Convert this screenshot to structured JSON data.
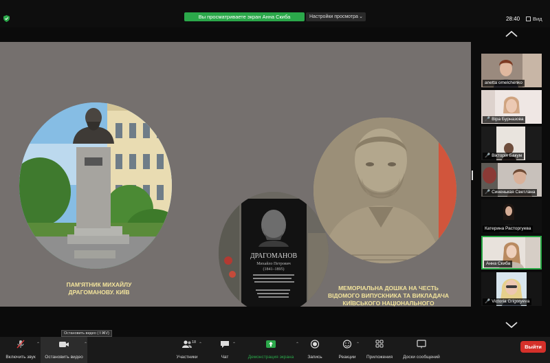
{
  "top_bar": {
    "share_banner": "Вы просматриваете экран Анна Скиба",
    "view_settings": "Настройки просмотра",
    "clock": "28:40",
    "view_label": "Вид"
  },
  "slide": {
    "caption1": "ПАМ'ЯТНИК МИХАЙЛУ ДРАГОМАНОВУ. КИЇВ",
    "caption2": "МЕМОРІАЛЬНА ДОШКА НА ЧЕСТЬ ВІДОМОГО ВИПУСКНИКА ТА ВИКЛАДАЧА КИЇВСЬКОГО НАЦІОНАЛЬНОГО УНІВЕРСИТЕТУ ІМЕНІ Т.ШЕВЧЕНКА",
    "plaque_name": "ДРАГОМАНОВ",
    "plaque_sub": "Михайло Петрович",
    "plaque_years": "(1841–1895)"
  },
  "participants": [
    {
      "name": "anetta omelchenko",
      "muted": false
    },
    {
      "name": "Віра Бурназова",
      "muted": true
    },
    {
      "name": "Вікторія Бакум",
      "muted": true
    },
    {
      "name": "Синенькая Светлана",
      "muted": true
    },
    {
      "name": "Катерина Расторгуева",
      "muted": false
    },
    {
      "name": "Анна Скиба",
      "muted": false
    },
    {
      "name": "Victoria Grigoryeva",
      "muted": true
    }
  ],
  "toolbar": {
    "tooltip": "Остановить видео (⇧⌘V)",
    "audio": "Включить звук",
    "video": "Остановить видео",
    "participants": "Участники",
    "participants_count": "18",
    "chat": "Чат",
    "share": "Демонстрация экрана",
    "record": "Запись",
    "reactions": "Реакции",
    "apps": "Приложения",
    "whiteboards": "Доски сообщений",
    "exit": "Выйти"
  },
  "colors": {
    "share_green": "#2ba84a",
    "slide_bg": "#75706e",
    "caption": "#f3e49c",
    "exit_red": "#d5302a",
    "active_speaker": "#27a844"
  }
}
